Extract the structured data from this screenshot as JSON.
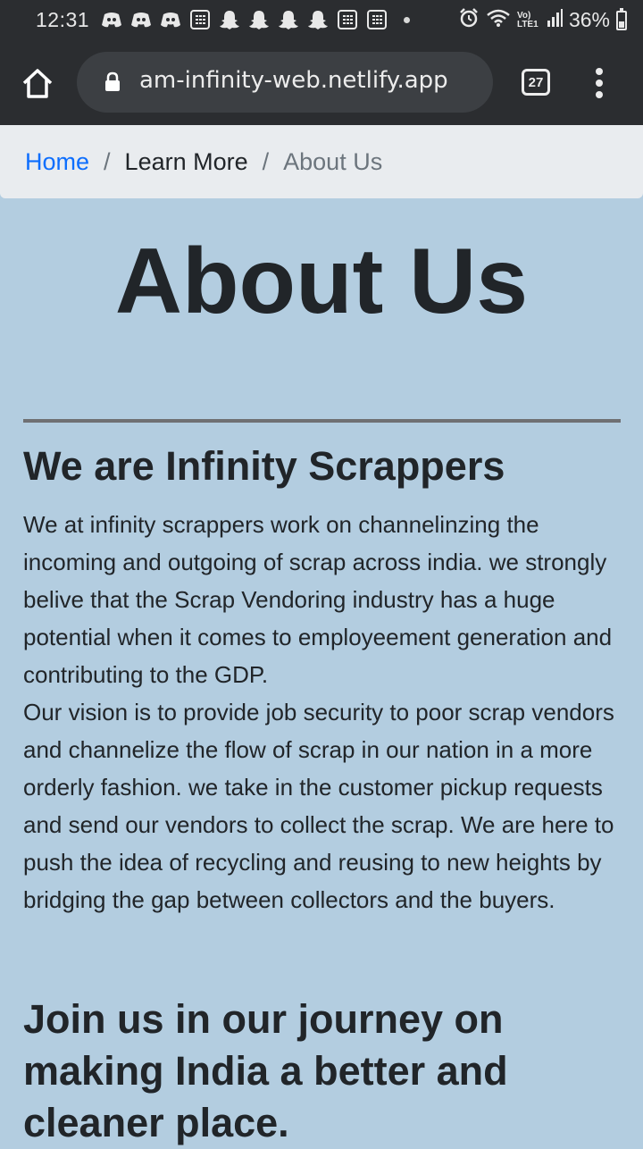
{
  "status_bar": {
    "time": "12:31",
    "battery_percent": "36%",
    "battery_level": 0.36,
    "left_icons": [
      "discord-icon",
      "discord-icon",
      "discord-icon",
      "grid-app-icon",
      "snapchat-icon",
      "snapchat-icon",
      "snapchat-icon",
      "snapchat-icon",
      "grid-app-icon",
      "grid-app-icon",
      "dot-icon"
    ],
    "right_icons": [
      "alarm-icon",
      "wifi-icon",
      "volte-icon",
      "signal-icon",
      "battery-icon"
    ],
    "network_label": "Vo) LTE1"
  },
  "browser": {
    "url": "am-infinity-web.netlify.app",
    "tab_count": "27",
    "icons": [
      "home-icon",
      "lock-icon",
      "tabs-icon",
      "more-vert-icon"
    ]
  },
  "breadcrumb": {
    "home": "Home",
    "learn_more": "Learn More",
    "current": "About Us",
    "separator": "/"
  },
  "main": {
    "title": "About Us",
    "section_heading": "We are Infinity Scrappers",
    "paragraph_1": "We at infinity scrappers work on channelinzing the incoming and outgoing of scrap across india. we strongly belive that the Scrap Vendoring industry has a huge potential when it comes to employeement generation and contributing to the GDP.",
    "paragraph_2": "Our vision is to provide job security to poor scrap vendors and channelize the flow of scrap in our nation in a more orderly fashion. we take in the customer pickup requests and send our vendors to collect the scrap. We are here to push the idea of recycling and reusing to new heights by bridging the gap between collectors and the buyers.",
    "join_heading": "Join us in our journey on making India a better and cleaner place."
  },
  "colors": {
    "page_background": "#b3cde0",
    "browser_chrome": "#2b2d30",
    "link": "#0d6efd",
    "breadcrumb_bg": "#e9ecef",
    "text": "#212529"
  }
}
